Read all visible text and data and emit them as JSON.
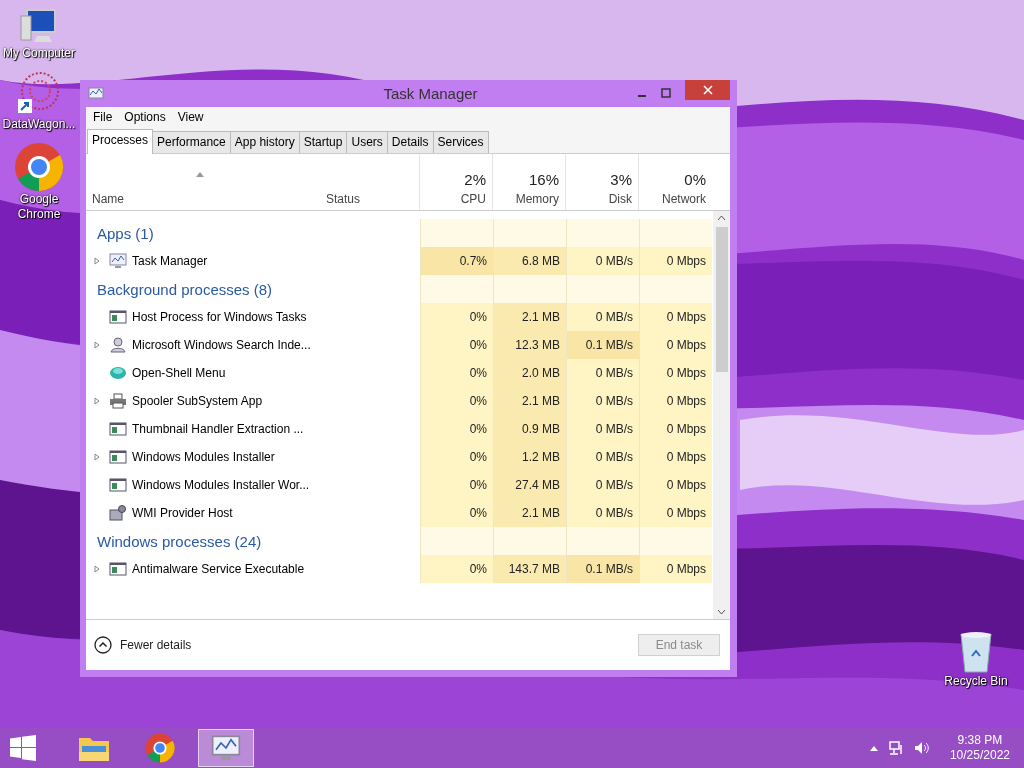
{
  "desktop_icons": [
    {
      "label": "My Computer",
      "kind": "computer"
    },
    {
      "label": "DataWagon...",
      "kind": "shortcut"
    },
    {
      "label": "Google Chrome",
      "kind": "chrome"
    }
  ],
  "recycle_bin": {
    "label": "Recycle Bin"
  },
  "window": {
    "title": "Task Manager"
  },
  "menu": [
    "File",
    "Options",
    "View"
  ],
  "tabs": [
    {
      "label": "Processes",
      "selected": true
    },
    {
      "label": "Performance",
      "selected": false
    },
    {
      "label": "App history",
      "selected": false
    },
    {
      "label": "Startup",
      "selected": false
    },
    {
      "label": "Users",
      "selected": false
    },
    {
      "label": "Details",
      "selected": false
    },
    {
      "label": "Services",
      "selected": false
    }
  ],
  "columns": [
    {
      "label": "Name"
    },
    {
      "label": "Status"
    },
    {
      "label": "CPU",
      "total": "2%"
    },
    {
      "label": "Memory",
      "total": "16%"
    },
    {
      "label": "Disk",
      "total": "3%"
    },
    {
      "label": "Network",
      "total": "0%"
    }
  ],
  "groups": [
    {
      "title": "Apps (1)",
      "rows": [
        {
          "name": "Task Manager",
          "kind": "taskmgr",
          "expandable": true,
          "cpu": "0.7%",
          "memory": "6.8 MB",
          "disk": "0 MB/s",
          "network": "0 Mbps"
        }
      ]
    },
    {
      "title": "Background processes (8)",
      "rows": [
        {
          "name": "Host Process for Windows Tasks",
          "kind": "window",
          "expandable": false,
          "cpu": "0%",
          "memory": "2.1 MB",
          "disk": "0 MB/s",
          "network": "0 Mbps"
        },
        {
          "name": "Microsoft Windows Search Inde...",
          "kind": "search",
          "expandable": true,
          "cpu": "0%",
          "memory": "12.3 MB",
          "disk": "0.1 MB/s",
          "network": "0 Mbps"
        },
        {
          "name": "Open-Shell Menu",
          "kind": "shell",
          "expandable": false,
          "cpu": "0%",
          "memory": "2.0 MB",
          "disk": "0 MB/s",
          "network": "0 Mbps"
        },
        {
          "name": "Spooler SubSystem App",
          "kind": "printer",
          "expandable": true,
          "cpu": "0%",
          "memory": "2.1 MB",
          "disk": "0 MB/s",
          "network": "0 Mbps"
        },
        {
          "name": "Thumbnail Handler Extraction ...",
          "kind": "window",
          "expandable": false,
          "cpu": "0%",
          "memory": "0.9 MB",
          "disk": "0 MB/s",
          "network": "0 Mbps"
        },
        {
          "name": "Windows Modules Installer",
          "kind": "window",
          "expandable": true,
          "cpu": "0%",
          "memory": "1.2 MB",
          "disk": "0 MB/s",
          "network": "0 Mbps"
        },
        {
          "name": "Windows Modules Installer Wor...",
          "kind": "window",
          "expandable": false,
          "cpu": "0%",
          "memory": "27.4 MB",
          "disk": "0 MB/s",
          "network": "0 Mbps"
        },
        {
          "name": "WMI Provider Host",
          "kind": "wmi",
          "expandable": false,
          "cpu": "0%",
          "memory": "2.1 MB",
          "disk": "0 MB/s",
          "network": "0 Mbps"
        }
      ]
    },
    {
      "title": "Windows processes (24)",
      "rows": [
        {
          "name": "Antimalware Service Executable",
          "kind": "window",
          "expandable": true,
          "cpu": "0%",
          "memory": "143.7 MB",
          "disk": "0.1 MB/s",
          "network": "0 Mbps"
        }
      ]
    }
  ],
  "footer": {
    "details": "Fewer details",
    "end_task": {
      "label": "End task",
      "disabled": true
    }
  },
  "taskbar": {
    "apps": [
      {
        "kind": "explorer",
        "selected": false
      },
      {
        "kind": "chrome",
        "selected": false
      },
      {
        "kind": "taskmgr",
        "selected": true
      }
    ],
    "time": "9:38 PM",
    "date": "10/25/2022"
  }
}
